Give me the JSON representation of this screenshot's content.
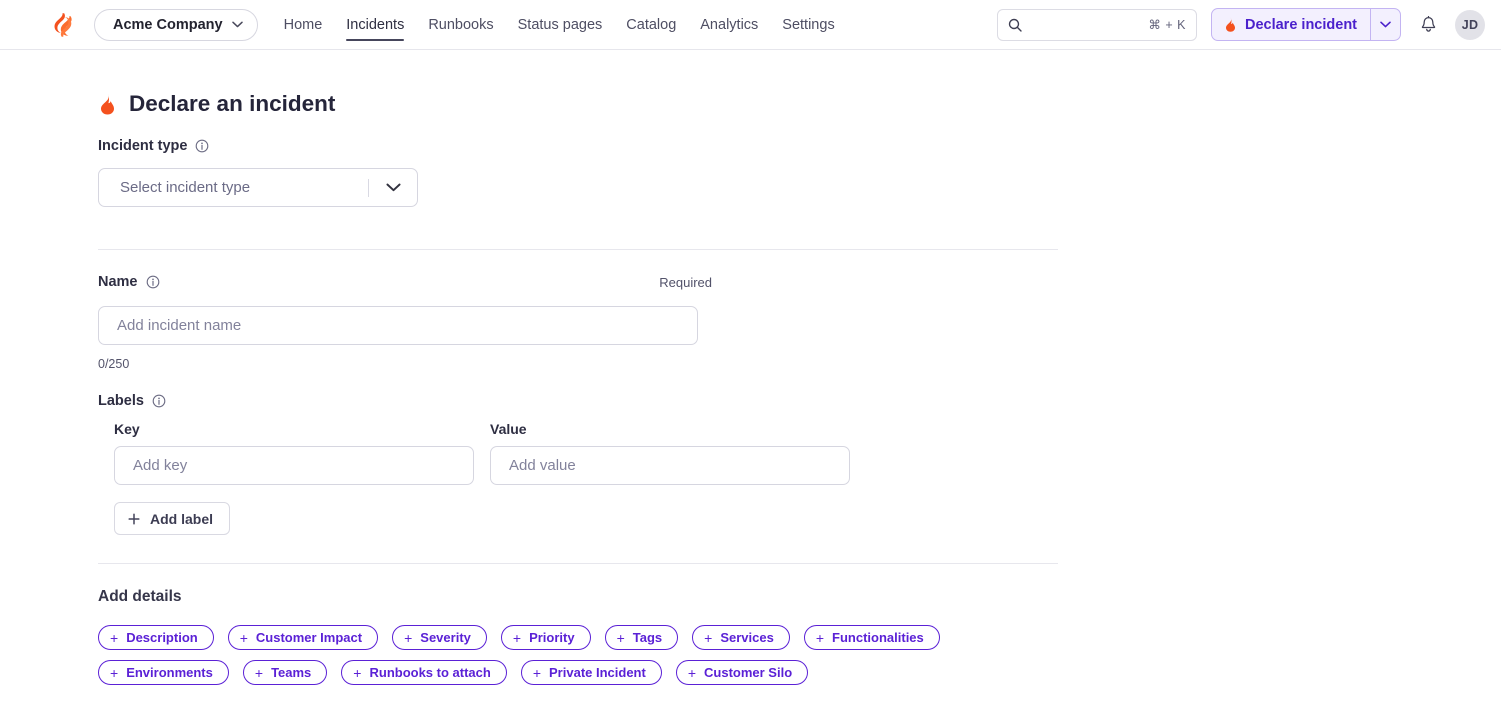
{
  "topbar": {
    "logo_icon": "flame-logo-icon",
    "org_selector": {
      "label": "Acme Company",
      "chevron_icon": "chevron-down-icon"
    },
    "nav": [
      {
        "label": "Home",
        "active": false
      },
      {
        "label": "Incidents",
        "active": true
      },
      {
        "label": "Runbooks",
        "active": false
      },
      {
        "label": "Status pages",
        "active": false
      },
      {
        "label": "Catalog",
        "active": false
      },
      {
        "label": "Analytics",
        "active": false
      },
      {
        "label": "Settings",
        "active": false
      }
    ],
    "search": {
      "icon": "search-icon",
      "placeholder": "",
      "value": "",
      "shortcut": "⌘ + K"
    },
    "declare_button": {
      "label": "Declare incident",
      "icon": "flame-icon",
      "dropdown_icon": "chevron-down-icon",
      "text_color": "#4b21cc",
      "bg_color": "#f3f0fe",
      "border_color": "#c3b4f2"
    },
    "notifications_icon": "bell-icon",
    "avatar": {
      "initials": "JD"
    }
  },
  "main": {
    "title": "Declare an incident",
    "title_icon": "flame-icon",
    "incident_type": {
      "label": "Incident type",
      "info_icon": "info-circle-icon",
      "placeholder": "Select incident type",
      "value": "",
      "chevron_icon": "chevron-down-icon"
    },
    "name": {
      "label": "Name",
      "info_icon": "info-circle-icon",
      "required_text": "Required",
      "placeholder": "Add incident name",
      "value": "",
      "counter": "0/250"
    },
    "labels": {
      "label": "Labels",
      "info_icon": "info-circle-icon",
      "key_header": "Key",
      "value_header": "Value",
      "key_placeholder": "Add key",
      "key_value": "",
      "value_placeholder": "Add value",
      "value_value": "",
      "add_button": {
        "label": "Add label",
        "icon": "plus-icon"
      }
    },
    "add_details": {
      "heading": "Add details",
      "accent_color": "#5b21d6",
      "chips": [
        {
          "label": "Description"
        },
        {
          "label": "Customer Impact"
        },
        {
          "label": "Severity"
        },
        {
          "label": "Priority"
        },
        {
          "label": "Tags"
        },
        {
          "label": "Services"
        },
        {
          "label": "Functionalities"
        },
        {
          "label": "Environments"
        },
        {
          "label": "Teams"
        },
        {
          "label": "Runbooks to attach"
        },
        {
          "label": "Private Incident"
        },
        {
          "label": "Customer Silo"
        }
      ]
    }
  }
}
